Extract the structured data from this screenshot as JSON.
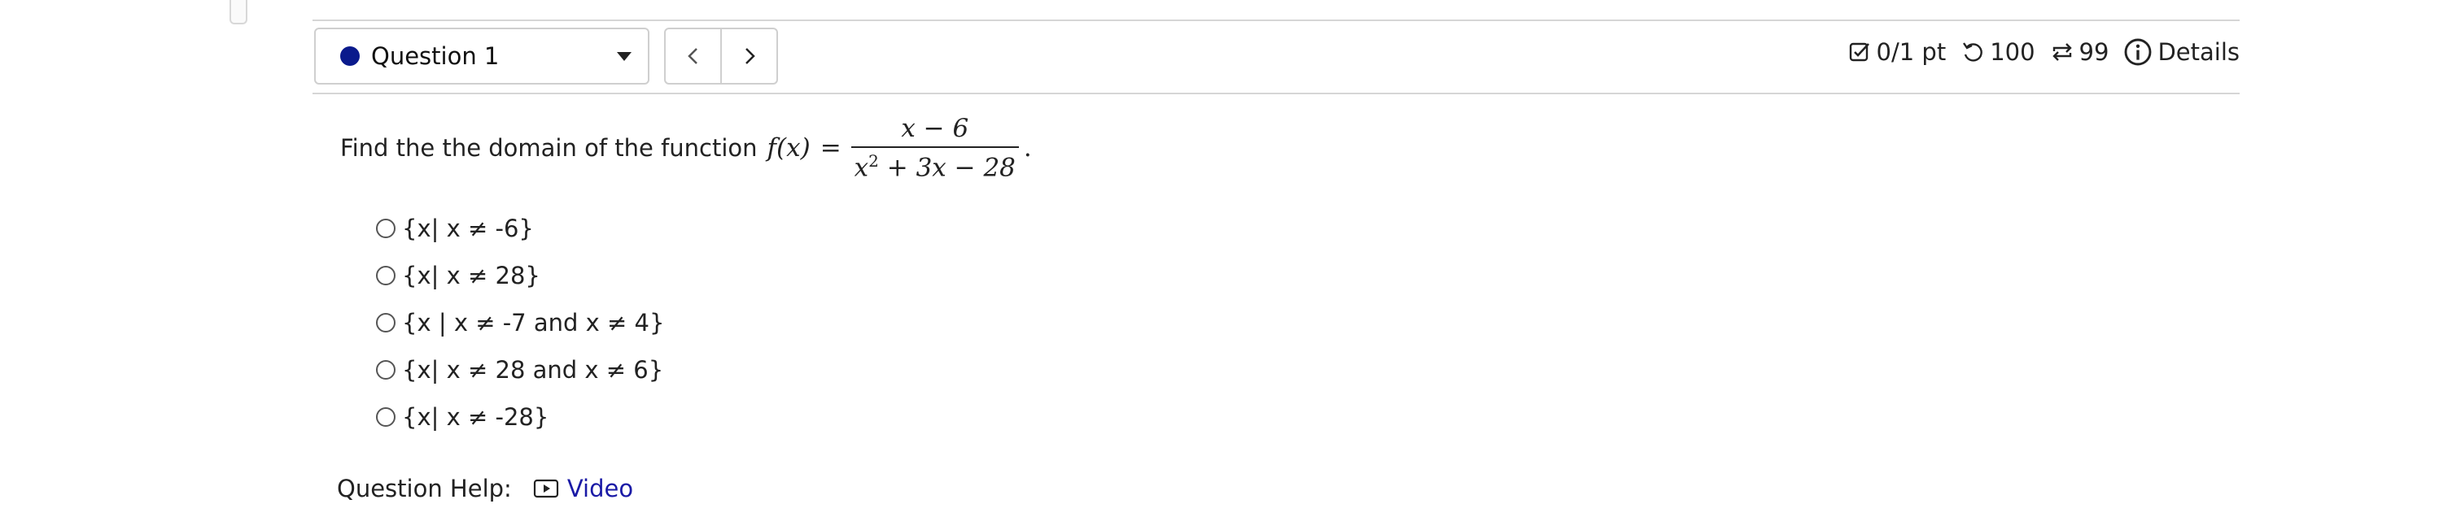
{
  "question_select": {
    "label": "Question 1",
    "dot_color": "#0a1a8c"
  },
  "nav": {
    "prev_icon": "chevron-left-icon",
    "next_icon": "chevron-right-icon"
  },
  "meta": {
    "points": "0/1 pt",
    "retries": "100",
    "attempts": "99",
    "details": "Details"
  },
  "question": {
    "prompt": "Find the the domain of the function",
    "function_name": "f(x)",
    "equals": "=",
    "numerator": "x − 6",
    "denominator_lead": "x",
    "denominator_exp": "2",
    "denominator_rest": " + 3x − 28",
    "period": "."
  },
  "options": [
    {
      "label": "{x| x ≠ -6}"
    },
    {
      "label": "{x| x ≠ 28}"
    },
    {
      "label": "{x | x ≠ -7 and x ≠ 4}"
    },
    {
      "label": "{x| x ≠ 28 and x ≠ 6}"
    },
    {
      "label": "{x| x ≠ -28}"
    }
  ],
  "help": {
    "label": "Question Help:",
    "video_label": "Video"
  }
}
